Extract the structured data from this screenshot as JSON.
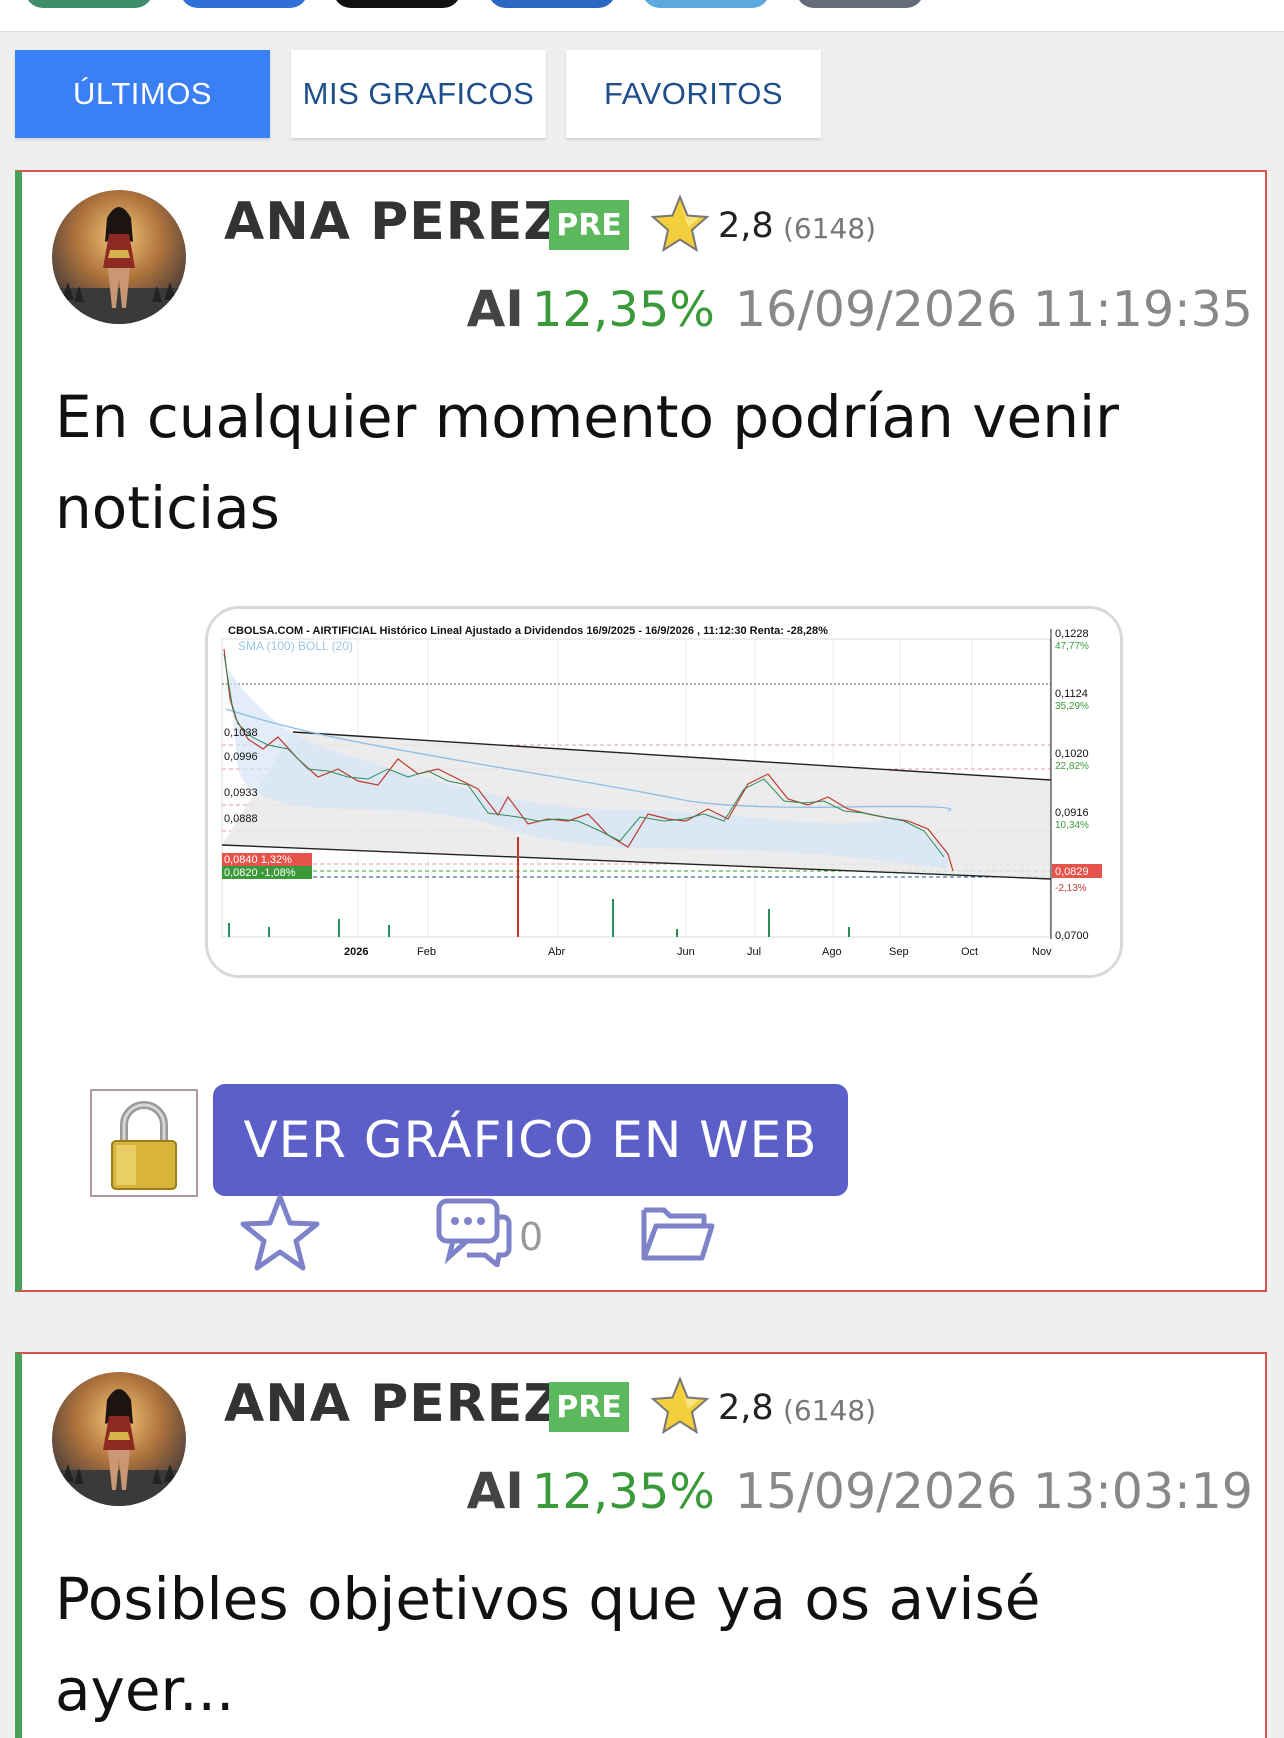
{
  "tabs": [
    {
      "label": "ÚLTIMOS",
      "active": true
    },
    {
      "label": "MIS GRAFICOS",
      "active": false
    },
    {
      "label": "FAVORITOS",
      "active": false
    }
  ],
  "posts": [
    {
      "author": "ANA PEREZ",
      "badge": "PRE",
      "rating": "2,8",
      "votes": "(6148)",
      "ai_label": "AI",
      "ai_percent": "12,35%",
      "date": "16/09/2026 11:19:35",
      "text": "En cualquier momento podrían venir noticias",
      "chart_header": "CBOLSA.COM - AIRTIFICIAL Histórico Lineal Ajustado a Dividendos 16/9/2025 - 16/9/2026 , 11:12:30 Renta: -28,28%",
      "chart_legend": "SMA (100) BOLL (20)",
      "chart_right_labels": [
        {
          "price": "0,1228",
          "pct": "47,77%"
        },
        {
          "price": "0,1124",
          "pct": "35,29%"
        },
        {
          "price": "0,1020",
          "pct": "22,82%"
        },
        {
          "price": "0,0916",
          "pct": "10,34%"
        },
        {
          "price": "0,0829",
          "pct": "-2,13%"
        },
        {
          "price": "0,0700",
          "pct": ""
        }
      ],
      "chart_left_labels": [
        "0,1038",
        "0,0996",
        "0,0933",
        "0,0888",
        "0,0840 1,32%",
        "0,0820 -1,08%"
      ],
      "chart_x_labels": [
        "2026",
        "Feb",
        "Abr",
        "Jun",
        "Jul",
        "Ago",
        "Sep",
        "Oct",
        "Nov"
      ],
      "view_button": "VER GRÁFICO EN WEB",
      "comments": "0"
    },
    {
      "author": "ANA PEREZ",
      "badge": "PRE",
      "rating": "2,8",
      "votes": "(6148)",
      "ai_label": "AI",
      "ai_percent": "12,35%",
      "date": "15/09/2026 13:03:19",
      "text": "Posibles objetivos que ya os avisé ayer..."
    }
  ],
  "colors": {
    "tab_active": "#3b7ff5",
    "tab_text": "#1f4e8c",
    "badge_green": "#5cb85c",
    "percent_green": "#3a9a3a",
    "view_button": "#5b5fc7",
    "card_border_red": "#d9534f",
    "card_border_green": "#4aa05a"
  },
  "icons": {
    "rating": "star-icon",
    "lock": "lock-icon",
    "favorite": "star-outline-icon",
    "comments": "comment-bubble-icon",
    "folder": "folder-icon"
  }
}
